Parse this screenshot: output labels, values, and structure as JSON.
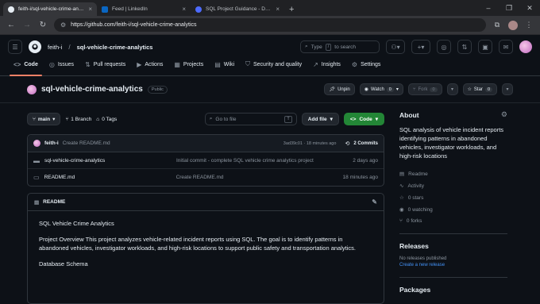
{
  "browser": {
    "tabs": [
      {
        "title": "feith-i/sql-vehicle-crime-analy",
        "active": true,
        "favicon_color": "#e6edf3"
      },
      {
        "title": "Feed | LinkedIn",
        "active": false,
        "favicon_color": "#0a66c2"
      },
      {
        "title": "SQL Project Guidance - DeepSe",
        "active": false,
        "favicon_color": "#4d6bfe"
      }
    ],
    "url": "https://github.com/feith-i/sql-vehicle-crime-analytics"
  },
  "header": {
    "owner": "feith-i",
    "separator": "/",
    "repo": "sql-vehicle-crime-analytics",
    "search_placeholder": "Type",
    "search_hint": "to search",
    "search_key": "/"
  },
  "repo_nav": [
    {
      "label": "Code",
      "icon": "code-icon",
      "glyph": "<>",
      "current": true
    },
    {
      "label": "Issues",
      "icon": "issue-icon",
      "glyph": "◎"
    },
    {
      "label": "Pull requests",
      "icon": "pull-request-icon",
      "glyph": "⇅"
    },
    {
      "label": "Actions",
      "icon": "play-icon",
      "glyph": "▶"
    },
    {
      "label": "Projects",
      "icon": "table-icon",
      "glyph": "▦"
    },
    {
      "label": "Wiki",
      "icon": "book-icon",
      "glyph": "▤"
    },
    {
      "label": "Security and quality",
      "icon": "shield-icon",
      "glyph": "⛉"
    },
    {
      "label": "Insights",
      "icon": "graph-icon",
      "glyph": "↗"
    },
    {
      "label": "Settings",
      "icon": "gear-icon",
      "glyph": "⚙"
    }
  ],
  "title_bar": {
    "name": "sql-vehicle-crime-analytics",
    "visibility": "Public",
    "unpin": "Unpin",
    "watch": "Watch",
    "watch_count": "0",
    "fork": "Fork",
    "fork_count": "0",
    "star": "Star",
    "star_count": "0"
  },
  "toolbar": {
    "branch": "main",
    "branches": "1 Branch",
    "tags": "0 Tags",
    "goto_placeholder": "Go to file",
    "goto_key": "T",
    "add_file": "Add file",
    "code": "Code"
  },
  "commit": {
    "author": "feith-i",
    "message": "Create README.md",
    "hash_time": "3ad39c01 · 18 minutes ago",
    "commits": "2 Commits"
  },
  "files": [
    {
      "name": "sql-vehicle-crime-analytics",
      "type": "folder",
      "message": "Initial commit - complete SQL vehicle crime analytics project",
      "date": "2 days ago"
    },
    {
      "name": "README.md",
      "type": "file",
      "message": "Create README.md",
      "date": "18 minutes ago"
    }
  ],
  "readme": {
    "tab": "README",
    "title": "SQL Vehicle Crime Analytics",
    "overview": "Project Overview This project analyzes vehicle-related incident reports using SQL. The goal is to identify patterns in abandoned vehicles, investigator workloads, and high-risk locations to support public safety and transportation analytics.",
    "schema": "Database Schema"
  },
  "sidebar": {
    "about_title": "About",
    "description": "SQL analysis of vehicle incident reports identifying patterns in abandoned vehicles, investigator workloads, and high-risk locations",
    "items": [
      {
        "label": "Readme",
        "icon": "book-icon",
        "glyph": "▤"
      },
      {
        "label": "Activity",
        "icon": "pulse-icon",
        "glyph": "∿"
      },
      {
        "label": "0 stars",
        "icon": "star-icon",
        "glyph": "☆"
      },
      {
        "label": "0 watching",
        "icon": "eye-icon",
        "glyph": "◉"
      },
      {
        "label": "0 forks",
        "icon": "fork-icon",
        "glyph": "⑂"
      }
    ],
    "releases_title": "Releases",
    "releases_text": "No releases published",
    "releases_link": "Create a new release",
    "packages_title": "Packages"
  },
  "colors": {
    "accent_green": "#238636",
    "link_blue": "#4493f8",
    "nav_underline": "#f78166"
  }
}
